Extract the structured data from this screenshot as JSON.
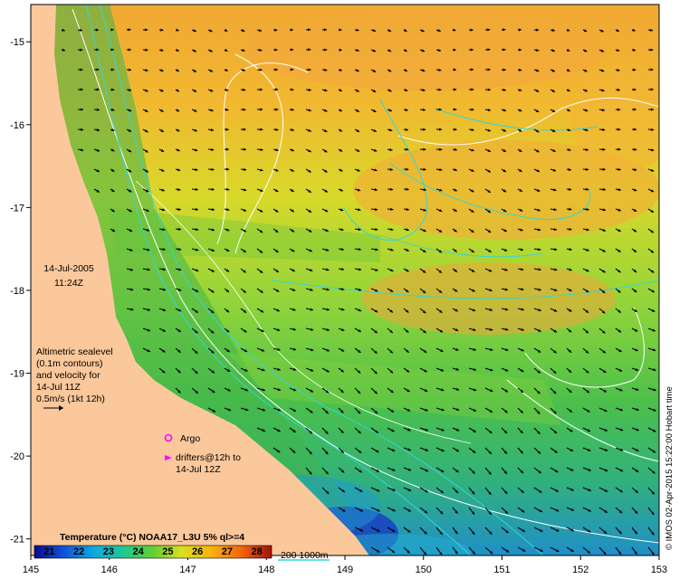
{
  "map": {
    "lon_ticks": [
      "145",
      "146",
      "147",
      "148",
      "149",
      "150",
      "151",
      "152",
      "153"
    ],
    "lat_ticks": [
      "-15",
      "-16",
      "-17",
      "-18",
      "-19",
      "-20",
      "-21"
    ],
    "lon_range": [
      145,
      153
    ],
    "lat_range": [
      -21.2,
      -14.55
    ],
    "date_line1": "14-Jul-2005",
    "date_line2": "11:24Z",
    "legend_lines": [
      "Altimetric sealevel",
      "(0.1m contours)",
      "and velocity for",
      "14-Jul 11Z",
      "0.5m/s (1kt 12h)"
    ],
    "argo_label": "Argo",
    "drifters_line1": "drifters@12h to",
    "drifters_line2": "14-Jul 12Z",
    "credit": "© IMOS 02-Apr-2015 15:22:00 Hobart time",
    "colorbar_title": "Temperature (°C) NOAA17_L3U 5% ql>=4",
    "colorbar_ticks": [
      "21",
      "22",
      "23",
      "24",
      "25",
      "26",
      "27",
      "28"
    ],
    "colorbar_range": [
      20.5,
      28.5
    ],
    "isobath_label": "200  1000m",
    "colors": {
      "land": "#fbc89b",
      "contour": "#ffffff",
      "isobath": "#33d6d6",
      "argo": "#ff00ff",
      "drifter": "#ff00ff",
      "arrow": "#000000"
    }
  }
}
